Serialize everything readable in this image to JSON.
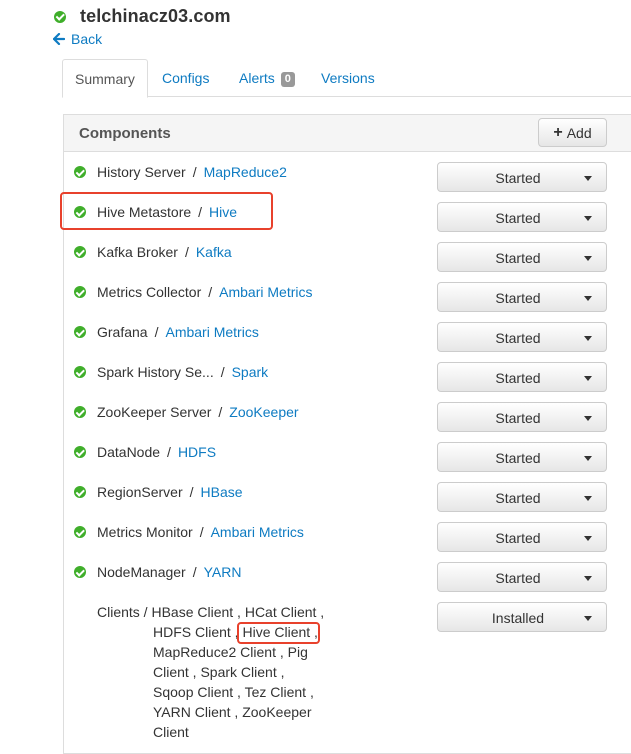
{
  "host": {
    "name": "telchinacz03.com",
    "back_label": "Back"
  },
  "tabs": {
    "summary": "Summary",
    "configs": "Configs",
    "alerts": "Alerts",
    "alerts_count": "0",
    "versions": "Versions"
  },
  "components_panel": {
    "title": "Components",
    "add_label": "Add"
  },
  "components": [
    {
      "name": "History Server",
      "service": "MapReduce2",
      "status": "Started"
    },
    {
      "name": "Hive Metastore",
      "service": "Hive",
      "status": "Started"
    },
    {
      "name": "Kafka Broker",
      "service": "Kafka",
      "status": "Started"
    },
    {
      "name": "Metrics Collector",
      "service": "Ambari Metrics",
      "status": "Started"
    },
    {
      "name": "Grafana",
      "service": "Ambari Metrics",
      "status": "Started"
    },
    {
      "name": "Spark History Se...",
      "service": "Spark",
      "status": "Started"
    },
    {
      "name": "ZooKeeper Server",
      "service": "ZooKeeper",
      "status": "Started"
    },
    {
      "name": "DataNode",
      "service": "HDFS",
      "status": "Started"
    },
    {
      "name": "RegionServer",
      "service": "HBase",
      "status": "Started"
    },
    {
      "name": "Metrics Monitor",
      "service": "Ambari Metrics",
      "status": "Started"
    },
    {
      "name": "NodeManager",
      "service": "YARN",
      "status": "Started"
    }
  ],
  "clients": {
    "label": "Clients",
    "status": "Installed",
    "lines": [
      "Clients / HBase Client , HCat Client ,",
      "HDFS Client , ",
      "Hive Client",
      " ,",
      "MapReduce2 Client , Pig",
      "Client , Spark Client ,",
      "Sqoop Client , Tez Client ,",
      "YARN Client , ZooKeeper",
      "Client"
    ]
  },
  "colors": {
    "status_ok": "#3fae2a",
    "link": "#0e7bc2",
    "highlight": "#e8412c"
  }
}
